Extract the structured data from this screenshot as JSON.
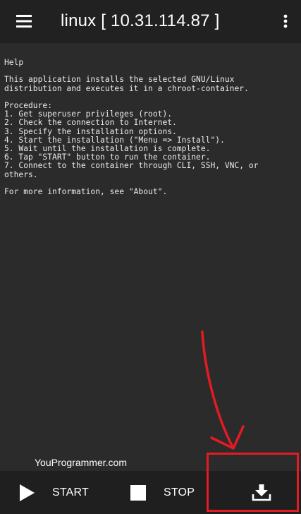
{
  "app_bar": {
    "title": "linux  [ 10.31.114.87 ]",
    "menu_icon": "hamburger-menu-icon",
    "overflow_icon": "more-vert-icon"
  },
  "log": {
    "lines": [
      "Help",
      "",
      "This application installs the selected GNU/Linux",
      "distribution and executes it in a chroot-container.",
      "",
      "Procedure:",
      "1. Get superuser privileges (root).",
      "2. Check the connection to Internet.",
      "3. Specify the installation options.",
      "4. Start the installation (\"Menu => Install\").",
      "5. Wait until the installation is complete.",
      "6. Tap \"START\" button to run the container.",
      "7. Connect to the container through CLI, SSH, VNC, or",
      "others.",
      "",
      "For more information, see \"About\"."
    ]
  },
  "watermark": "YouProgrammer.com",
  "bottom_bar": {
    "start_label": "START",
    "stop_label": "STOP",
    "start_icon": "play-icon",
    "stop_icon": "stop-square-icon",
    "install_icon": "download-icon"
  },
  "colors": {
    "app_bar": "#212121",
    "background": "#2b2b2b",
    "bottom_bar": "#1f1f1f",
    "text": "#ebebeb",
    "annotation": "#e31b23"
  }
}
